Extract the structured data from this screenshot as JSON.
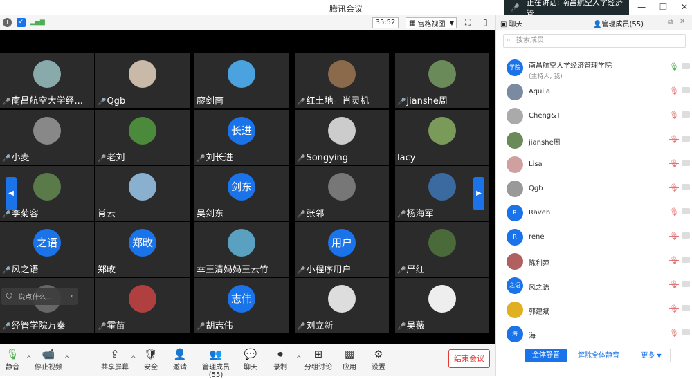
{
  "app": {
    "title": "腾讯会议"
  },
  "speaking": {
    "label": "正在讲话: 南昌航空大学经济管..."
  },
  "toolbar": {
    "timer": "35:52",
    "view_label": "宫格视图"
  },
  "tiles": [
    {
      "name": "南昌航空大学经...",
      "avatar_text": "",
      "color": "#8aa",
      "mic": true
    },
    {
      "name": "Qgb",
      "avatar_text": "",
      "color": "#c9b9a8",
      "mic": true
    },
    {
      "name": "廖剑南",
      "avatar_text": "",
      "color": "#4aa3df",
      "mic": false
    },
    {
      "name": "红土地。肖灵机",
      "avatar_text": "",
      "color": "#8a6a4a",
      "mic": true
    },
    {
      "name": "jianshe周",
      "avatar_text": "",
      "color": "#6a8a5a",
      "mic": true
    },
    {
      "name": "小麦",
      "avatar_text": "",
      "color": "#888",
      "mic": true
    },
    {
      "name": "老刘",
      "avatar_text": "",
      "color": "#4a8a3a",
      "mic": true
    },
    {
      "name": "刘长进",
      "avatar_text": "长进",
      "color": "#1a73e8",
      "mic": true
    },
    {
      "name": "Songying",
      "avatar_text": "",
      "color": "#ccc",
      "mic": true
    },
    {
      "name": "lacy",
      "avatar_text": "",
      "color": "#7a9a5a",
      "mic": false
    },
    {
      "name": "李菊容",
      "avatar_text": "",
      "color": "#5a7a4a",
      "mic": true
    },
    {
      "name": "肖云",
      "avatar_text": "",
      "color": "#8ab0d0",
      "mic": false
    },
    {
      "name": "吴剑东",
      "avatar_text": "剑东",
      "color": "#1a73e8",
      "mic": false
    },
    {
      "name": "张邻",
      "avatar_text": "",
      "color": "#777",
      "mic": true
    },
    {
      "name": "杨海军",
      "avatar_text": "",
      "color": "#3a6aa0",
      "mic": true
    },
    {
      "name": "风之语",
      "avatar_text": "之语",
      "color": "#1a73e8",
      "mic": true
    },
    {
      "name": "郑畋",
      "avatar_text": "郑畋",
      "color": "#1a73e8",
      "mic": false
    },
    {
      "name": "幸王清妈妈王云竹",
      "avatar_text": "",
      "color": "#5aa0c0",
      "mic": false
    },
    {
      "name": "小程序用户",
      "avatar_text": "用户",
      "color": "#1a73e8",
      "mic": true
    },
    {
      "name": "严红",
      "avatar_text": "",
      "color": "#4a6a3a",
      "mic": true
    },
    {
      "name": "经管学院万秦",
      "avatar_text": "",
      "color": "#666",
      "mic": true
    },
    {
      "name": "霍苗",
      "avatar_text": "",
      "color": "#b04040",
      "mic": true
    },
    {
      "name": "胡志伟",
      "avatar_text": "志伟",
      "color": "#1a73e8",
      "mic": true
    },
    {
      "name": "刘立新",
      "avatar_text": "",
      "color": "#ddd",
      "mic": true
    },
    {
      "name": "吴薇",
      "avatar_text": "",
      "color": "#eee",
      "mic": true
    }
  ],
  "chat_placeholder": "说点什么...",
  "bottom": {
    "mute": "静音",
    "stop_video": "停止视频",
    "share": "共享屏幕",
    "security": "安全",
    "invite": "邀请",
    "members": "管理成员(55)",
    "chat": "聊天",
    "record": "录制",
    "breakout": "分组讨论",
    "apps": "应用",
    "settings": "设置",
    "end": "结束会议"
  },
  "panel": {
    "tab_chat": "聊天",
    "tab_members": "管理成员(55)",
    "search_placeholder": "搜索成员",
    "members": [
      {
        "name": "南昌航空大学经济管理学院",
        "sub": "(主持人, 我)",
        "avatar_text": "学院",
        "color": "#1a73e8",
        "mic_on": true
      },
      {
        "name": "Aquila",
        "sub": "",
        "avatar_text": "",
        "color": "#7a8aa0",
        "mic_on": false
      },
      {
        "name": "Cheng&T",
        "sub": "",
        "avatar_text": "",
        "color": "#aaa",
        "mic_on": false
      },
      {
        "name": "jianshe周",
        "sub": "",
        "avatar_text": "",
        "color": "#6a8a5a",
        "mic_on": false
      },
      {
        "name": "Lisa",
        "sub": "",
        "avatar_text": "",
        "color": "#d0a0a0",
        "mic_on": false
      },
      {
        "name": "Qgb",
        "sub": "",
        "avatar_text": "",
        "color": "#999",
        "mic_on": false
      },
      {
        "name": "Raven",
        "sub": "",
        "avatar_text": "R",
        "color": "#1a73e8",
        "mic_on": false
      },
      {
        "name": "rene",
        "sub": "",
        "avatar_text": "R",
        "color": "#1a73e8",
        "mic_on": false
      },
      {
        "name": "陈利萍",
        "sub": "",
        "avatar_text": "",
        "color": "#b06060",
        "mic_on": false
      },
      {
        "name": "风之语",
        "sub": "",
        "avatar_text": "之语",
        "color": "#1a73e8",
        "mic_on": false
      },
      {
        "name": "郭建斌",
        "sub": "",
        "avatar_text": "",
        "color": "#e0b020",
        "mic_on": false
      },
      {
        "name": "海",
        "sub": "",
        "avatar_text": "海",
        "color": "#1a73e8",
        "mic_on": false
      }
    ],
    "mute_all": "全体静音",
    "unmute_all": "解除全体静音",
    "more": "更多"
  }
}
